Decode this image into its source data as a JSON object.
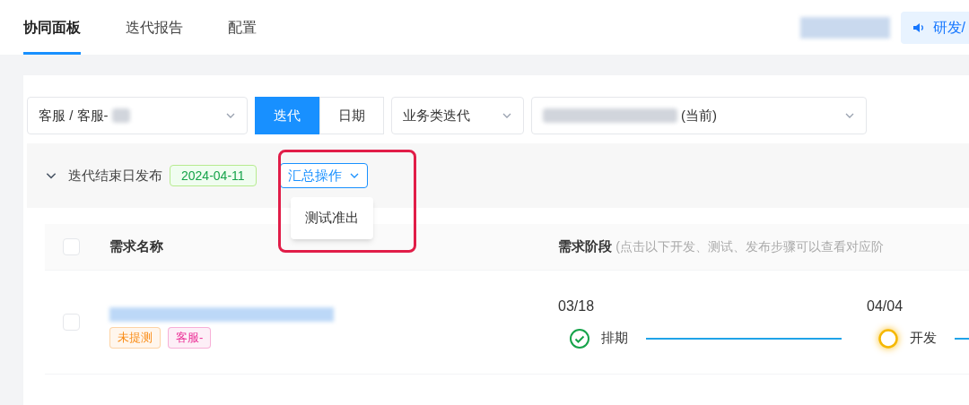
{
  "tabs": [
    {
      "label": "协同面板",
      "selected": true
    },
    {
      "label": "迭代报告",
      "selected": false
    },
    {
      "label": "配置",
      "selected": false
    }
  ],
  "header_button": {
    "label": "研发/"
  },
  "filters": {
    "team_select": {
      "value": "客服 / 客服-"
    },
    "mode_toggle": [
      {
        "label": "迭代",
        "selected": true
      },
      {
        "label": "日期",
        "selected": false
      }
    ],
    "type_select": {
      "value": "业务类迭代"
    },
    "iteration_select": {
      "value": "(当前)"
    }
  },
  "section": {
    "expanded": true,
    "title": "迭代结束日发布",
    "date_tag": "2024-04-11",
    "actions_button": {
      "label": "汇总操作"
    },
    "actions_menu": [
      {
        "label": "测试准出"
      }
    ]
  },
  "table": {
    "select_all": {
      "checked": false
    },
    "columns": [
      {
        "label": "需求名称"
      },
      {
        "label": "需求阶段",
        "hint": "(点击以下开发、测试、发布步骤可以查看对应阶"
      }
    ],
    "rows": [
      {
        "checked": false,
        "tags": [
          {
            "label": "未提测",
            "color": "#fa8c16"
          },
          {
            "label": "客服-",
            "color": "#eb2f96"
          }
        ],
        "stages": [
          {
            "date": "03/18",
            "label": "排期",
            "done": true,
            "active": false
          },
          {
            "date": "04/04",
            "label": "开发",
            "done": false,
            "active": true
          }
        ]
      }
    ]
  }
}
